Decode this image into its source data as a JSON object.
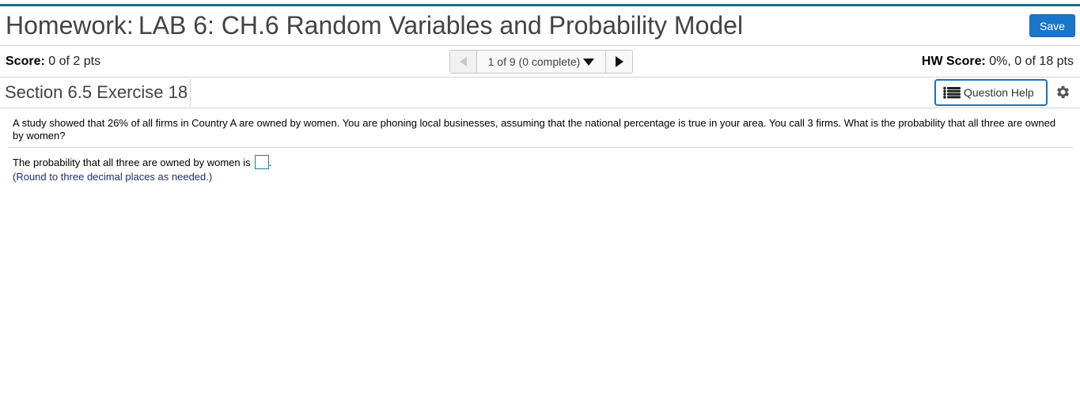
{
  "header": {
    "title_prefix": "Homework:",
    "title": "LAB 6: CH.6 Random Variables and Probability Model",
    "save_label": "Save"
  },
  "score_bar": {
    "score_label": "Score:",
    "score_value": "0 of 2 pts",
    "nav_position": "1 of 9 (0 complete)",
    "hw_score_label": "HW Score:",
    "hw_score_value": "0%, 0 of 18 pts"
  },
  "section": {
    "title": "Section 6.5 Exercise 18",
    "help_label": "Question Help"
  },
  "question": {
    "text": "A study showed that 26% of all firms in Country A are owned by women. You are phoning local businesses, assuming that the national percentage is true in your area. You call 3 firms. What is the probability that all three are owned by women?",
    "answer_prompt": "The probability that all three are owned by women is",
    "answer_value": "",
    "answer_suffix": ".",
    "note": "(Round to three decimal places as needed.)"
  },
  "colors": {
    "accent": "#1976c9",
    "top_rule": "#1a6e8a",
    "note_text": "#1f2d7a"
  },
  "icons": [
    "triangle-left-icon",
    "caret-down-icon",
    "triangle-right-icon",
    "list-icon",
    "gear-icon"
  ]
}
